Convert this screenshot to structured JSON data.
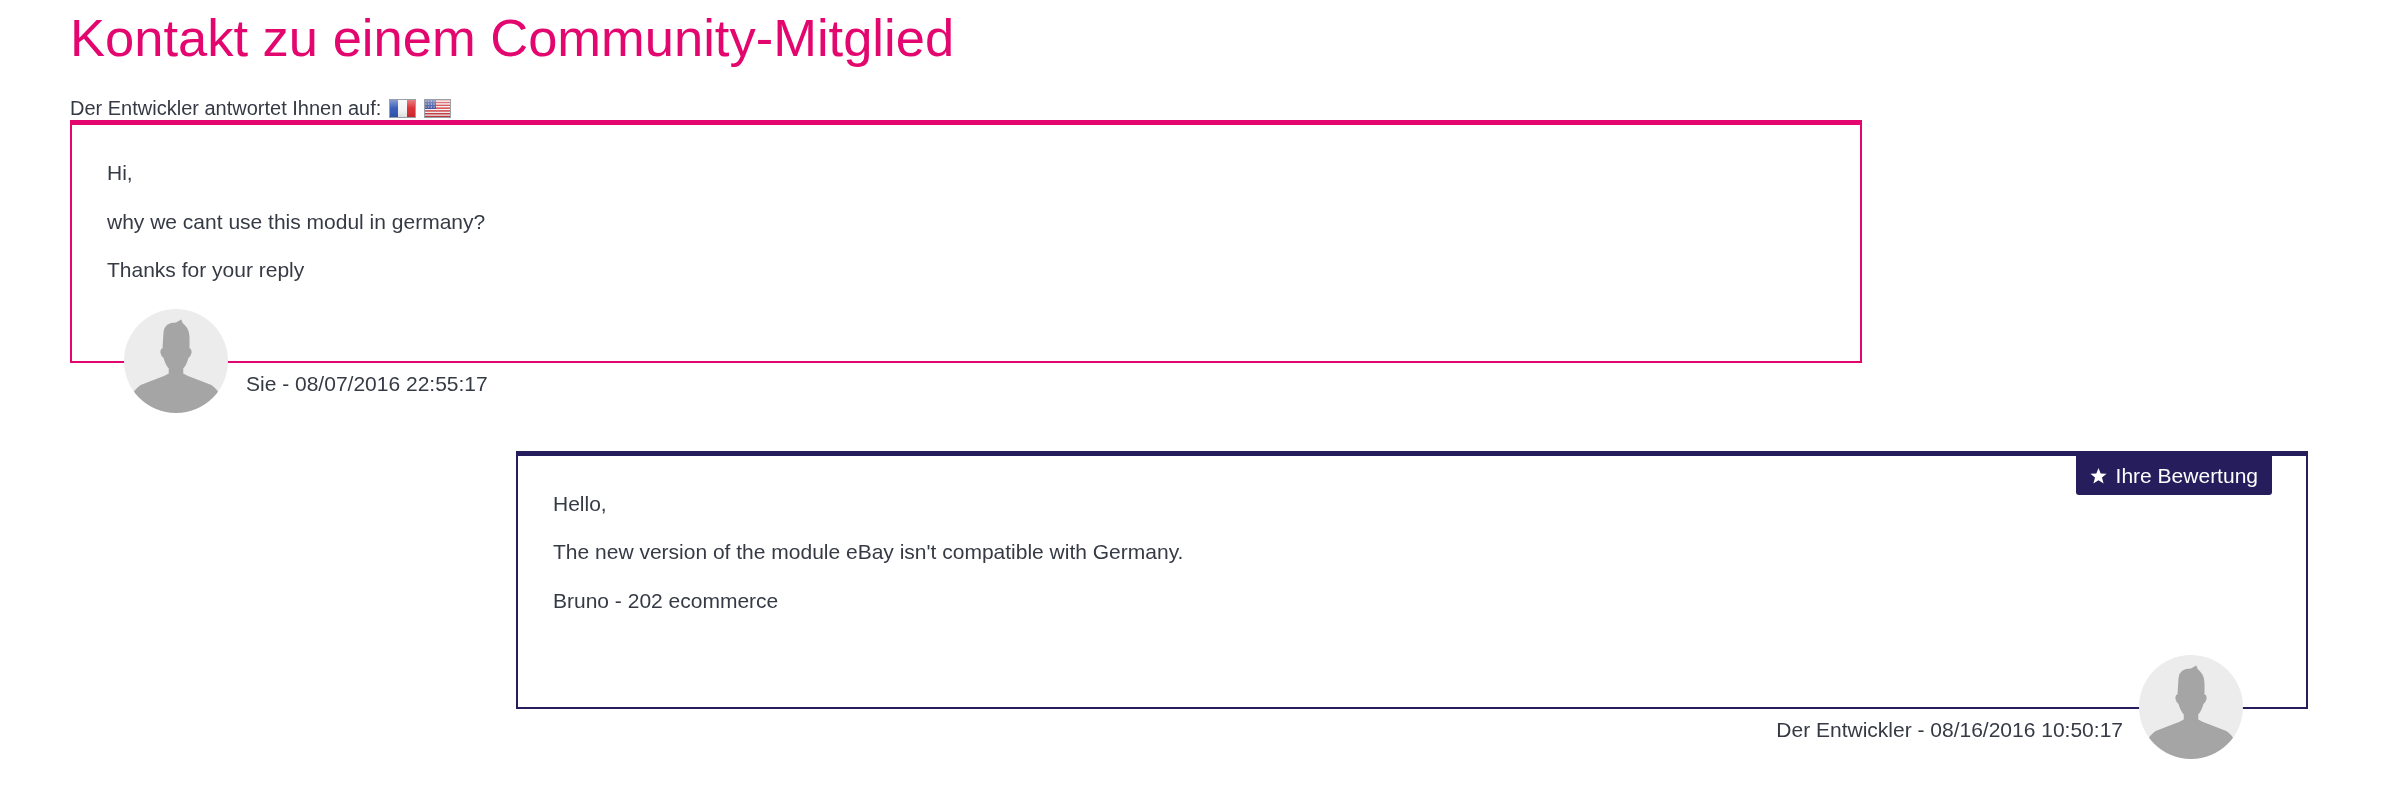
{
  "page_title": "Kontakt zu einem Community-Mitglied",
  "reply_language_label": "Der Entwickler antwortet Ihnen auf:",
  "messages": [
    {
      "kind": "sent",
      "paragraphs": [
        "Hi,",
        "why we cant use this modul in germany?",
        "Thanks for your reply"
      ],
      "caption": "Sie - 08/07/2016 22:55:17"
    },
    {
      "kind": "received",
      "rating_button": "Ihre Bewertung",
      "paragraphs": [
        "Hello,",
        "The new version of the module eBay isn't compatible with Germany.",
        "Bruno - 202 ecommerce"
      ],
      "caption": "Der Entwickler - 08/16/2016 10:50:17"
    }
  ]
}
